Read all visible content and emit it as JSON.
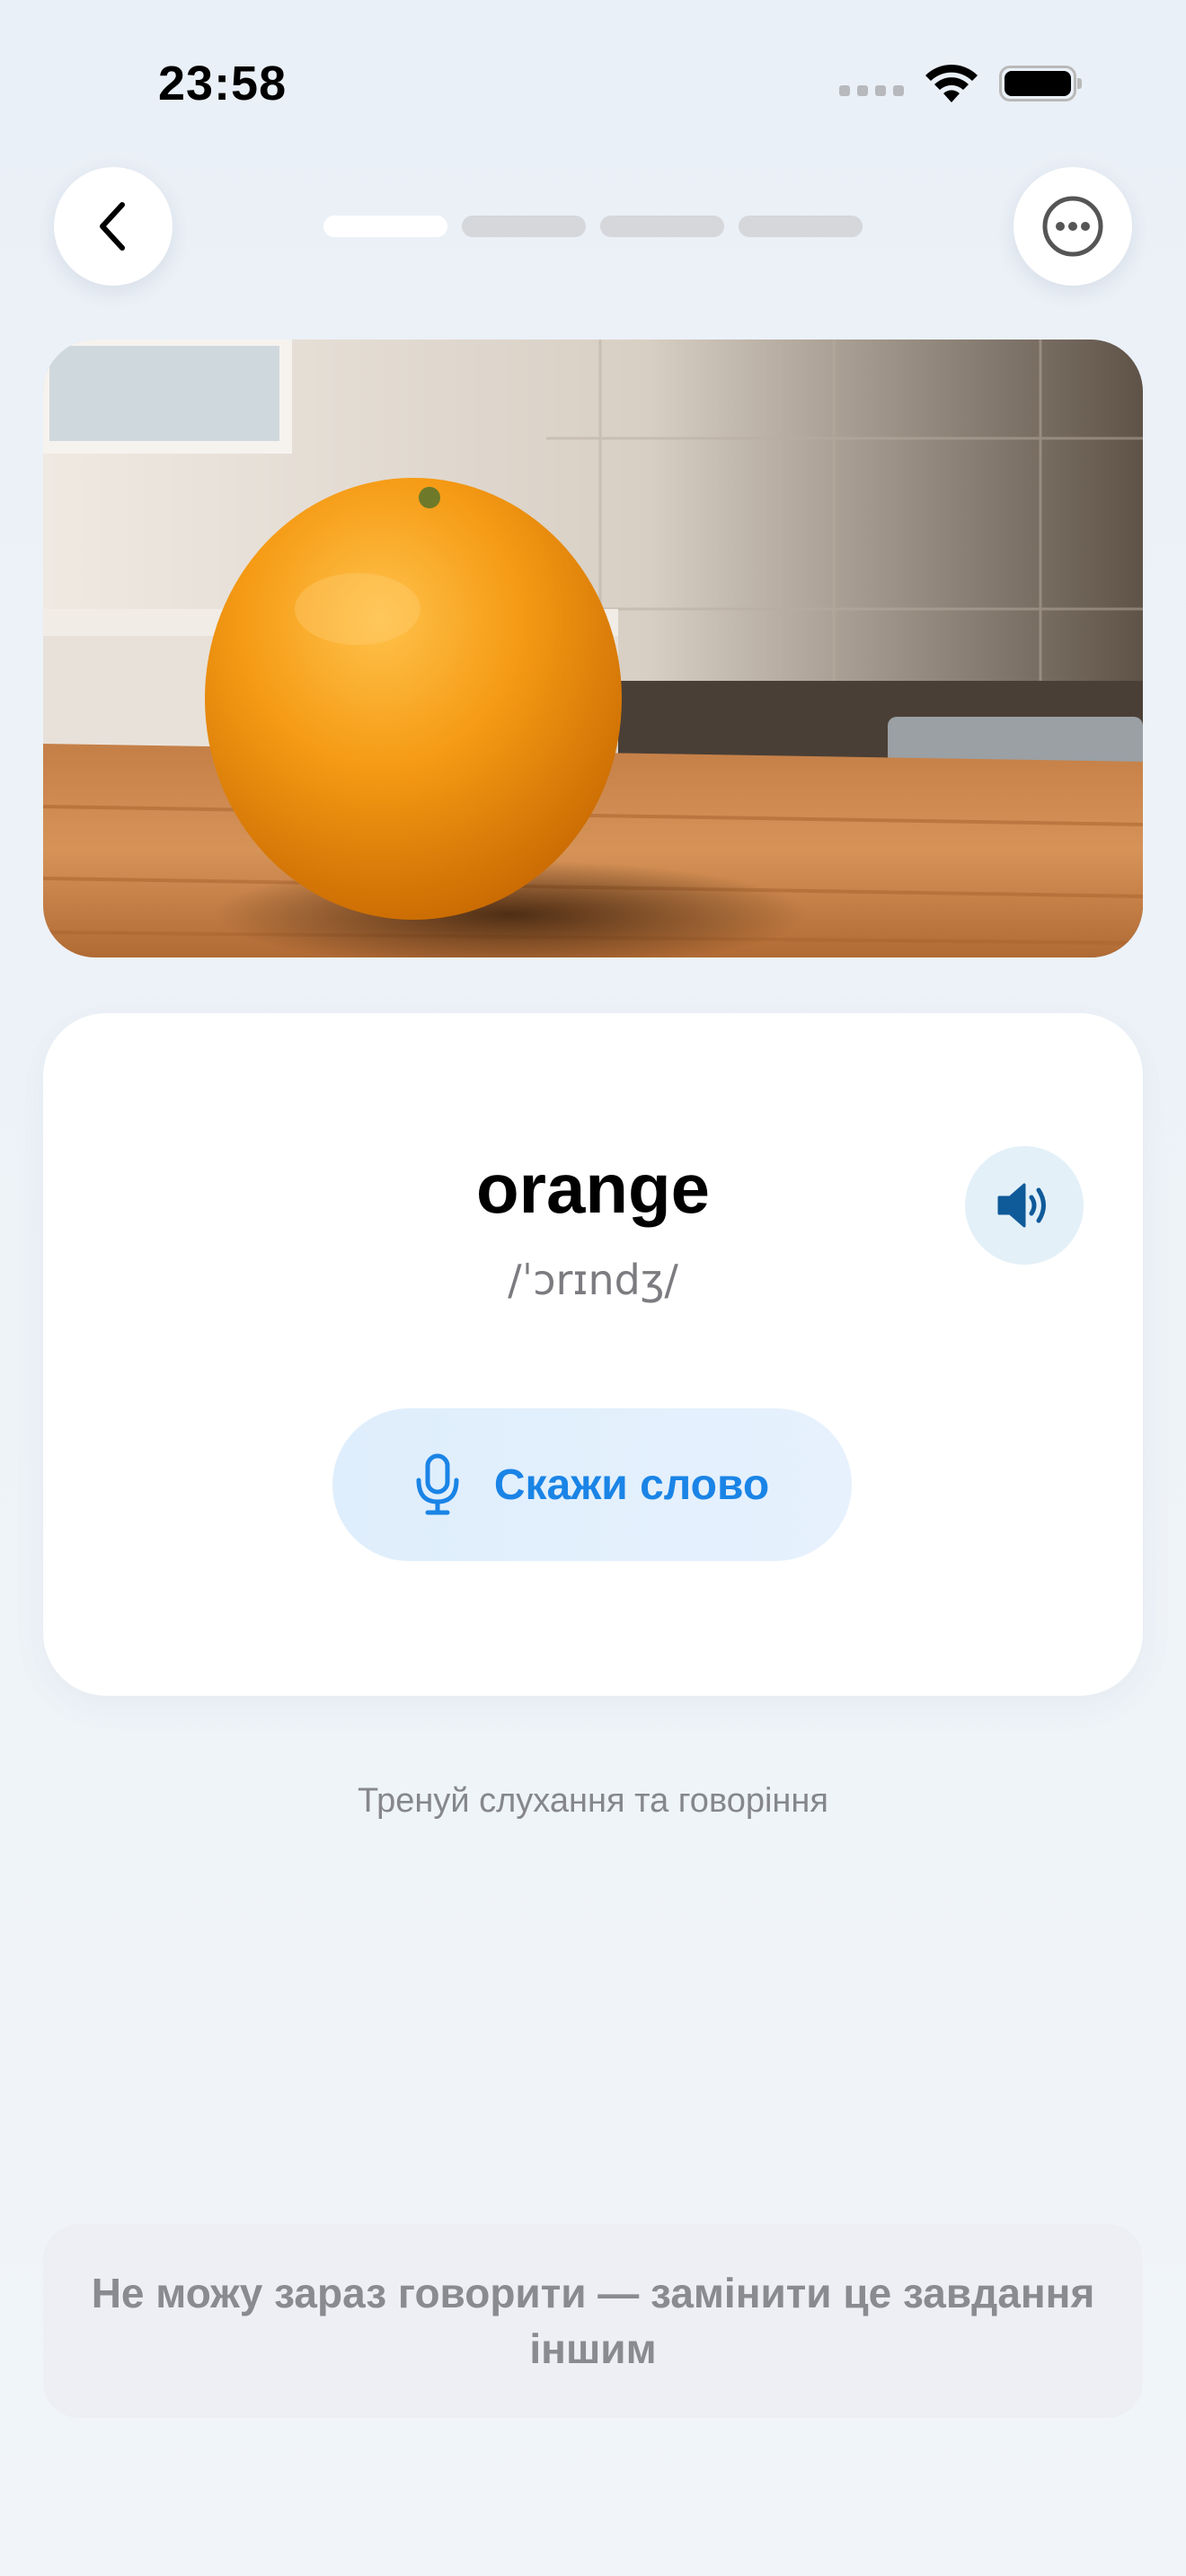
{
  "status_bar": {
    "time": "23:58",
    "icons": [
      "cellular-dots-icon",
      "wifi-icon",
      "battery-icon"
    ]
  },
  "header": {
    "back_icon": "chevron-left-icon",
    "more_icon": "ellipsis-circle-icon",
    "progress_steps": 4,
    "progress_current": 1
  },
  "photo": {
    "subject": "orange-photo"
  },
  "card": {
    "word": "orange",
    "transcription": "/ˈɔrɪndʒ/",
    "sound_icon": "speaker-icon",
    "say_button": {
      "label": "Скажи слово",
      "icon": "microphone-icon"
    }
  },
  "hint": "Тренуй слухання та говоріння",
  "skip_button": {
    "label": "Не можу зараз говорити — замінити це завдання іншим"
  },
  "colors": {
    "accent": "#1a84e6",
    "background": "#eef3f8",
    "card": "#ffffff",
    "sound_button_bg": "#e3f0f8"
  }
}
